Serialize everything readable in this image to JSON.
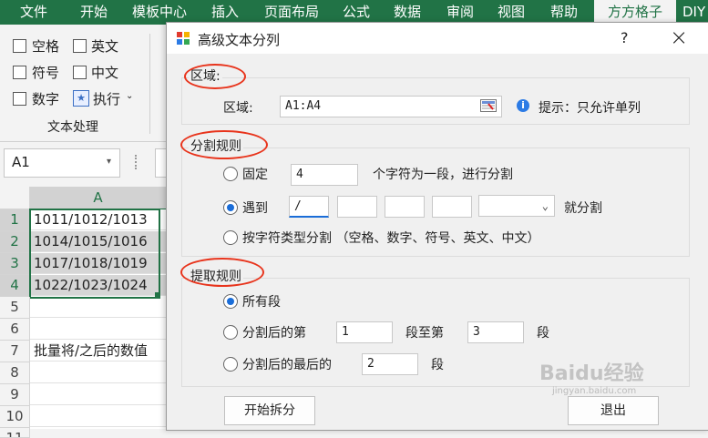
{
  "ribbon": {
    "tabs": [
      "文件",
      "开始",
      "模板中心",
      "插入",
      "页面布局",
      "公式",
      "数据",
      "审阅",
      "视图",
      "帮助",
      "方方格子",
      "DIY"
    ],
    "active_tab": "方方格子",
    "group": {
      "label": "文本处理",
      "checkboxes": [
        "空格",
        "英文",
        "符号",
        "中文",
        "数字"
      ],
      "execute_label": "执行"
    }
  },
  "namebox": {
    "value": "A1"
  },
  "sheet": {
    "column_header": "A",
    "rows": [
      {
        "num": "1",
        "value": "1011/1012/1013"
      },
      {
        "num": "2",
        "value": "1014/1015/1016"
      },
      {
        "num": "3",
        "value": "1017/1018/1019"
      },
      {
        "num": "4",
        "value": "1022/1023/1024"
      },
      {
        "num": "5",
        "value": ""
      },
      {
        "num": "6",
        "value": ""
      },
      {
        "num": "7",
        "value": "批量将/之后的数值"
      },
      {
        "num": "8",
        "value": ""
      },
      {
        "num": "9",
        "value": ""
      },
      {
        "num": "10",
        "value": ""
      },
      {
        "num": "11",
        "value": ""
      }
    ]
  },
  "dialog": {
    "title": "高级文本分列",
    "help": "?",
    "close": "×",
    "region": {
      "group_title": "区域:",
      "label": "区域:",
      "value": "A1:A4",
      "hint": "提示：只允许单列"
    },
    "split": {
      "group_title": "分割规则",
      "fixed_label": "固定",
      "fixed_value": "4",
      "fixed_suffix": "个字符为一段，进行分割",
      "meet_label": "遇到",
      "meet_values": [
        "/",
        "",
        "",
        ""
      ],
      "meet_dropdown": "",
      "meet_suffix": "就分割",
      "bytype_label": "按字符类型分割 （空格、数字、符号、英文、中文）",
      "selected": "meet"
    },
    "extract": {
      "group_title": "提取规则",
      "all_label": "所有段",
      "after_label": "分割后的第",
      "after_from": "1",
      "after_mid": "段至第",
      "after_to": "3",
      "after_suffix": "段",
      "last_label": "分割后的最后的",
      "last_value": "2",
      "last_suffix": "段",
      "selected": "all"
    },
    "start_button": "开始拆分",
    "exit_button": "退出"
  },
  "watermark": "Baidu经验",
  "watermark_sub": "jingyan.baidu.com",
  "colors": {
    "excel_green": "#217346",
    "highlight_red": "#e8341c",
    "radio_blue": "#1a6dd8"
  }
}
